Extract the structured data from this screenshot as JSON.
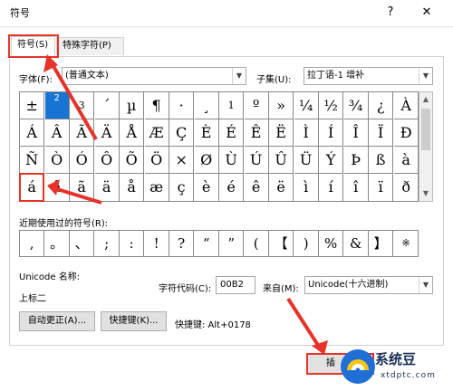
{
  "window": {
    "title": "符号",
    "help": "?",
    "close": "✕"
  },
  "tabs": [
    {
      "label": "符号(S)"
    },
    {
      "label": "特殊字符(P)"
    }
  ],
  "font": {
    "label": "字体(F):",
    "value": "(普通文本)"
  },
  "subset": {
    "label": "子集(U):",
    "value": "拉丁语-1 增补"
  },
  "grid": [
    [
      "±",
      "2",
      "3",
      "´",
      "µ",
      "¶",
      "·",
      "¸",
      "1",
      "º",
      "»",
      "¼",
      "½",
      "¾",
      "¿",
      "À"
    ],
    [
      "Á",
      "Â",
      "Ã",
      "Ä",
      "Å",
      "Æ",
      "Ç",
      "È",
      "É",
      "Ê",
      "Ë",
      "Ì",
      "Í",
      "Î",
      "Ï",
      "Ð"
    ],
    [
      "Ñ",
      "Ò",
      "Ó",
      "Ô",
      "Õ",
      "Ö",
      "×",
      "Ø",
      "Ù",
      "Ú",
      "Û",
      "Ü",
      "Ý",
      "Þ",
      "ß",
      "à"
    ],
    [
      "á",
      "â",
      "ã",
      "ä",
      "å",
      "æ",
      "ç",
      "è",
      "é",
      "ê",
      "ë",
      "ì",
      "í",
      "î",
      "ï",
      "ð"
    ]
  ],
  "recent": {
    "label": "近期使用过的符号(R):",
    "symbols": [
      ",",
      "。",
      "、",
      ";",
      ":",
      "!",
      "?",
      "“",
      "”",
      "(",
      "【",
      ")",
      "%",
      "&",
      "】",
      "※"
    ]
  },
  "unicode_name_label": "Unicode 名称:",
  "unicode_name": "上标二",
  "char_code": {
    "label": "字符代码(C):",
    "value": "00B2"
  },
  "from": {
    "label": "来自(M):",
    "value": "Unicode(十六进制)"
  },
  "buttons": {
    "autocorrect": "自动更正(A)...",
    "shortcut_key": "快捷键(K)...",
    "insert": "插"
  },
  "shortcut_text": "快捷键: Alt+0178",
  "watermark": {
    "name": "系统豆",
    "url": "xtdptc.com"
  },
  "colors": {
    "accent": "#1874d2",
    "highlight": "#e6332a"
  }
}
